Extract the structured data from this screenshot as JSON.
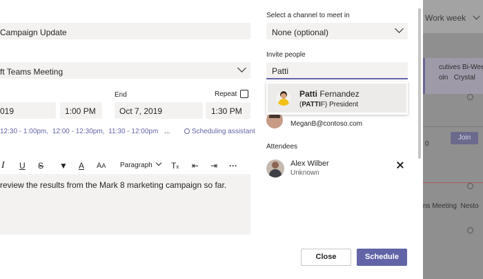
{
  "background": {
    "view_label": "Work week",
    "event_title": "cutives Bi-Weekly",
    "event_location": "oin",
    "event_organizer": "Crystal",
    "join_label": "Join",
    "slot_number": "0",
    "event2_title": "ns Meeting",
    "event2_organizer": "Nesto"
  },
  "form": {
    "title_value": "Campaign Update",
    "meeting_type_value": "ft Teams Meeting",
    "start_date": "019",
    "start_time": "1:00 PM",
    "end_label": "End",
    "end_date": "Oct 7, 2019",
    "end_time": "1:30 PM",
    "repeat_label": "Repeat",
    "suggested_times": [
      "12:30 - 1:00pm,",
      "12:00 - 12:30pm,",
      "11:30 - 12:00pm"
    ],
    "more_times": "...",
    "scheduling_assistant": "Scheduling assistant",
    "paragraph_label": "Paragraph",
    "body_text": "review the results from the Mark 8 marketing campaign so far."
  },
  "channel": {
    "label": "Select a channel to meet in",
    "value": "None (optional)"
  },
  "invite": {
    "label": "Invite people",
    "query": "Patti",
    "suggestion_first": "Patti",
    "suggestion_last": " Fernandez",
    "suggestion_alias_prefix": "(",
    "suggestion_alias_bold": "PATTI",
    "suggestion_alias_rest": "F) President"
  },
  "organizer": {
    "email": "MeganB@contoso.com"
  },
  "attendees": {
    "label": "Attendees",
    "items": [
      {
        "name": "Alex Wilber",
        "status": "Unknown"
      }
    ]
  },
  "buttons": {
    "close": "Close",
    "schedule": "Schedule"
  },
  "colors": {
    "accent": "#6264a7",
    "field_bg": "#f3f2f1"
  }
}
